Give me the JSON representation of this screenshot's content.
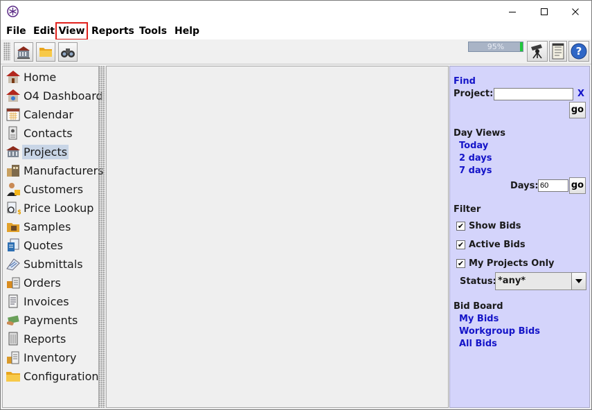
{
  "menu": {
    "file": "File",
    "edit": "Edit",
    "view": "View",
    "reports": "Reports",
    "tools": "Tools",
    "help": "Help"
  },
  "toolbar": {
    "left_icons": [
      "projects-building-icon",
      "folder-icon",
      "binoculars-icon"
    ],
    "right_icons": [
      "telescope-icon",
      "notepad-icon",
      "help-icon"
    ],
    "progress_text": "95%",
    "progress_value": 0.95
  },
  "sidebar": {
    "items": [
      {
        "label": "Home",
        "icon": "home-icon"
      },
      {
        "label": "O4 Dashboard",
        "icon": "dashboard-icon"
      },
      {
        "label": "Calendar",
        "icon": "calendar-icon"
      },
      {
        "label": "Contacts",
        "icon": "contacts-icon"
      },
      {
        "label": "Projects",
        "icon": "projects-icon",
        "selected": true
      },
      {
        "label": "Manufacturers",
        "icon": "manufacturers-icon"
      },
      {
        "label": "Customers",
        "icon": "customers-icon"
      },
      {
        "label": "Price Lookup",
        "icon": "price-lookup-icon"
      },
      {
        "label": "Samples",
        "icon": "samples-icon"
      },
      {
        "label": "Quotes",
        "icon": "quotes-icon"
      },
      {
        "label": "Submittals",
        "icon": "submittals-icon"
      },
      {
        "label": "Orders",
        "icon": "orders-icon"
      },
      {
        "label": "Invoices",
        "icon": "invoices-icon"
      },
      {
        "label": "Payments",
        "icon": "payments-icon"
      },
      {
        "label": "Reports",
        "icon": "reports-icon"
      },
      {
        "label": "Inventory",
        "icon": "inventory-icon"
      },
      {
        "label": "Configuration",
        "icon": "configuration-icon"
      }
    ]
  },
  "panel": {
    "find_heading": "Find",
    "project_label": "Project:",
    "project_value": "",
    "clear_label": "X",
    "go_label": "go",
    "day_views_heading": "Day Views",
    "today": "Today",
    "two_days": "2 days",
    "seven_days": "7 days",
    "days_label": "Days:",
    "days_value": "60",
    "filter_heading": "Filter",
    "show_bids": "Show Bids",
    "active_bids": "Active Bids",
    "my_projects_only": "My Projects Only",
    "check_mark": "✔",
    "status_label": "Status:",
    "status_value": "*any*",
    "bid_board_heading": "Bid Board",
    "my_bids": "My Bids",
    "workgroup_bids": "Workgroup Bids",
    "all_bids": "All Bids"
  },
  "colors": {
    "panel_bg": "#d4d4fb",
    "link_blue": "#1414c8",
    "highlight_red": "#e0201b",
    "selected_bg": "#c8d5e6"
  }
}
